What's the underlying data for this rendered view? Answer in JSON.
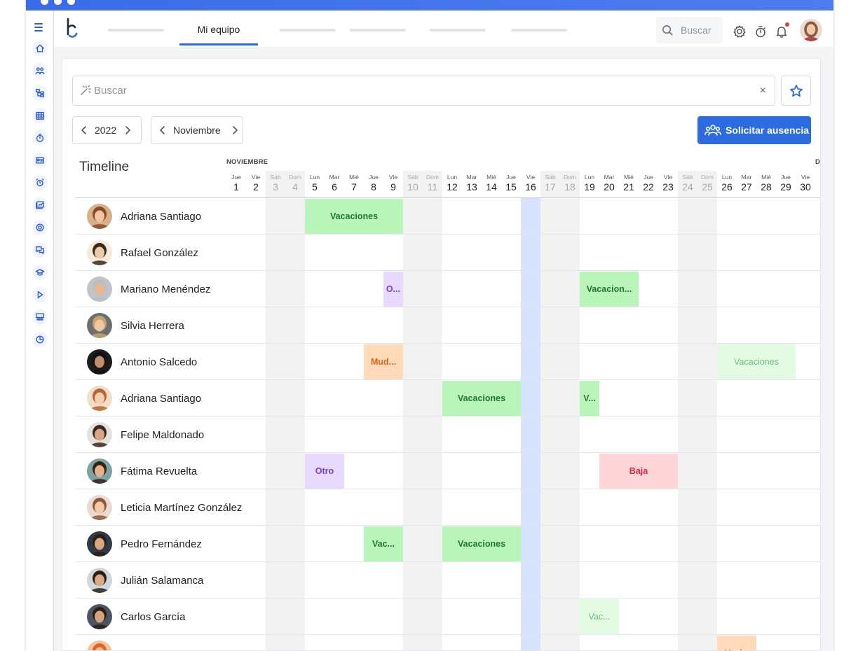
{
  "nav": {
    "active_tab": "Mi equipo",
    "search_placeholder": "Buscar"
  },
  "filter": {
    "placeholder": "Buscar",
    "clear_glyph": "×"
  },
  "controls": {
    "year": "2022",
    "month": "Noviembre",
    "request_button": "Solicitar ausencia"
  },
  "timeline": {
    "title": "Timeline",
    "month_label": "NOVIEMBRE",
    "next_month_label": "D",
    "today": 16,
    "days": [
      {
        "n": "1",
        "d": "Jue",
        "wk": false
      },
      {
        "n": "2",
        "d": "Vie",
        "wk": false
      },
      {
        "n": "3",
        "d": "Sáb",
        "wk": true
      },
      {
        "n": "4",
        "d": "Dom",
        "wk": true
      },
      {
        "n": "5",
        "d": "Lun",
        "wk": false
      },
      {
        "n": "6",
        "d": "Mar",
        "wk": false
      },
      {
        "n": "7",
        "d": "Mié",
        "wk": false
      },
      {
        "n": "8",
        "d": "Jue",
        "wk": false
      },
      {
        "n": "9",
        "d": "Vie",
        "wk": false
      },
      {
        "n": "10",
        "d": "Sáb",
        "wk": true
      },
      {
        "n": "11",
        "d": "Dom",
        "wk": true
      },
      {
        "n": "12",
        "d": "Lun",
        "wk": false
      },
      {
        "n": "13",
        "d": "Mar",
        "wk": false
      },
      {
        "n": "14",
        "d": "Mié",
        "wk": false
      },
      {
        "n": "15",
        "d": "Jue",
        "wk": false
      },
      {
        "n": "16",
        "d": "Vie",
        "wk": false
      },
      {
        "n": "17",
        "d": "Sáb",
        "wk": true
      },
      {
        "n": "18",
        "d": "Dom",
        "wk": true
      },
      {
        "n": "19",
        "d": "Lun",
        "wk": false
      },
      {
        "n": "20",
        "d": "Mar",
        "wk": false
      },
      {
        "n": "21",
        "d": "Mié",
        "wk": false
      },
      {
        "n": "22",
        "d": "Jue",
        "wk": false
      },
      {
        "n": "23",
        "d": "Vie",
        "wk": false
      },
      {
        "n": "24",
        "d": "Sáb",
        "wk": true
      },
      {
        "n": "25",
        "d": "Dom",
        "wk": true
      },
      {
        "n": "26",
        "d": "Lun",
        "wk": false
      },
      {
        "n": "27",
        "d": "Mar",
        "wk": false
      },
      {
        "n": "28",
        "d": "Mié",
        "wk": false
      },
      {
        "n": "29",
        "d": "Jue",
        "wk": false
      },
      {
        "n": "30",
        "d": "Vie",
        "wk": false
      }
    ],
    "people": [
      {
        "name": "Adriana Santiago",
        "skin": "#f1c4a3",
        "hair": "#8a4a2a",
        "bg": "#d8b08a"
      },
      {
        "name": "Rafael González",
        "skin": "#f0c9a8",
        "hair": "#3a2a1e",
        "bg": "#f6ead8"
      },
      {
        "name": "Mariano Menéndez",
        "skin": "#e7b896",
        "hair": "#bdbdbd",
        "bg": "#bfc4c9"
      },
      {
        "name": "Silvia Herrera",
        "skin": "#f0c7a6",
        "hair": "#c9a26a",
        "bg": "#6b6e72"
      },
      {
        "name": "Antonio Salcedo",
        "skin": "#c28f6b",
        "hair": "#111111",
        "bg": "#1c1c1c"
      },
      {
        "name": "Adriana Santiago",
        "skin": "#f3cfb1",
        "hair": "#b5652e",
        "bg": "#f4ddc7"
      },
      {
        "name": "Felipe Maldonado",
        "skin": "#d7a784",
        "hair": "#3b2a1f",
        "bg": "#e6e1da"
      },
      {
        "name": "Fátima Revuelta",
        "skin": "#e2b18e",
        "hair": "#3a1f14",
        "bg": "#7da3a4"
      },
      {
        "name": "Leticia Martínez González",
        "skin": "#f2c9ab",
        "hair": "#8e5a3a",
        "bg": "#ecd9d2"
      },
      {
        "name": "Pedro Fernández",
        "skin": "#d9a780",
        "hair": "#2a1e17",
        "bg": "#2f3a46"
      },
      {
        "name": "Julián Salamanca",
        "skin": "#d9aa86",
        "hair": "#2b2018",
        "bg": "#cfd6dc"
      },
      {
        "name": "Carlos García",
        "skin": "#d6a27e",
        "hair": "#2b1e16",
        "bg": "#4a5663"
      },
      {
        "name": "",
        "skin": "#f0b98f",
        "hair": "#e0622a",
        "bg": "#f5c49a"
      }
    ],
    "events": [
      {
        "row": 0,
        "start": 5,
        "end": 9,
        "type": "vac",
        "label": "Vacaciones"
      },
      {
        "row": 2,
        "start": 9,
        "end": 9,
        "type": "otro",
        "label": "O..."
      },
      {
        "row": 2,
        "start": 19,
        "end": 21,
        "type": "vac",
        "label": "Vacacion..."
      },
      {
        "row": 4,
        "start": 8,
        "end": 9,
        "type": "mud",
        "label": "Mud..."
      },
      {
        "row": 4,
        "start": 26,
        "end": 29,
        "type": "vac pale",
        "label": "Vacaciones"
      },
      {
        "row": 5,
        "start": 12,
        "end": 15,
        "type": "vac",
        "label": "Vacaciones"
      },
      {
        "row": 5,
        "start": 19,
        "end": 19,
        "type": "vac",
        "label": "V..."
      },
      {
        "row": 7,
        "start": 5,
        "end": 6,
        "type": "otro",
        "label": "Otro"
      },
      {
        "row": 7,
        "start": 20,
        "end": 23,
        "type": "baja",
        "label": "Baja"
      },
      {
        "row": 9,
        "start": 8,
        "end": 9,
        "type": "vac",
        "label": "Vac..."
      },
      {
        "row": 9,
        "start": 12,
        "end": 15,
        "type": "vac",
        "label": "Vacaciones"
      },
      {
        "row": 11,
        "start": 19,
        "end": 20,
        "type": "vac pale",
        "label": "Vac..."
      },
      {
        "row": 12,
        "start": 26,
        "end": 27,
        "type": "mud",
        "label": "Mud..."
      }
    ]
  }
}
